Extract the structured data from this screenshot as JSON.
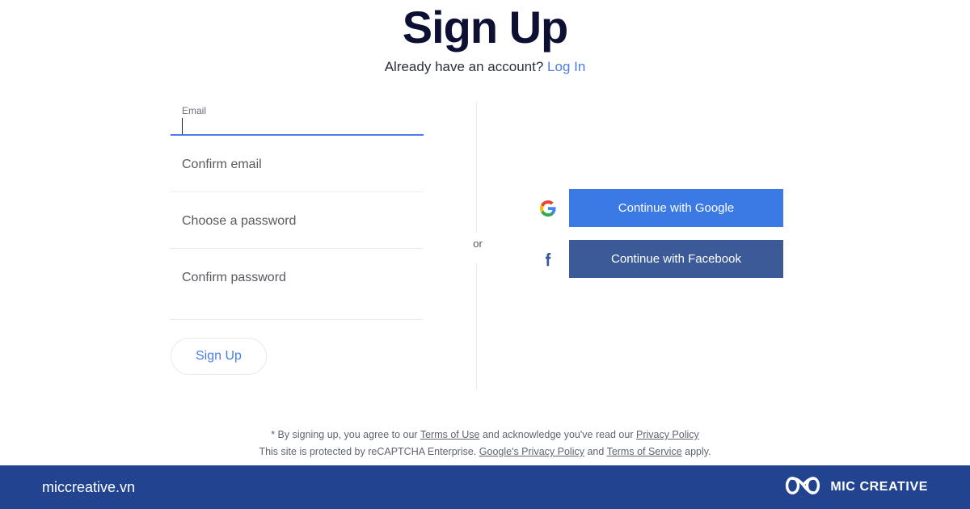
{
  "header": {
    "title": "Sign Up",
    "subtitle_text": "Already have an account?",
    "login_link": "Log In"
  },
  "form": {
    "email": {
      "label": "Email",
      "value": "",
      "placeholder": "Email",
      "focused": true
    },
    "confirm_email": {
      "placeholder": "Confirm email",
      "value": ""
    },
    "password": {
      "placeholder": "Choose a password",
      "value": ""
    },
    "confirm_password": {
      "placeholder": "Confirm password",
      "value": ""
    },
    "submit_label": "Sign Up"
  },
  "divider": {
    "or_label": "or"
  },
  "social": {
    "google": {
      "label": "Continue with Google",
      "icon": "google-g-icon",
      "color": "#3b7ae4"
    },
    "facebook": {
      "label": "Continue with Facebook",
      "icon": "facebook-f-icon",
      "color": "#3d5a98"
    }
  },
  "legal": {
    "line1_prefix": "* By signing up, you agree to our ",
    "terms_of_use": "Terms of Use",
    "line1_middle": " and acknowledge you've read our ",
    "privacy_policy": "Privacy Policy",
    "line2_prefix": "This site is protected by reCAPTCHA Enterprise. ",
    "google_privacy_policy": "Google's Privacy Policy",
    "line2_middle": " and ",
    "terms_of_service": "Terms of Service",
    "line2_suffix": " apply."
  },
  "brand_bar": {
    "site": "miccreative.vn",
    "name": "MIC CREATIVE",
    "logo": "infinity-knot-logo",
    "background": "#22438f"
  },
  "theme": {
    "accent_blue": "#4a7dea",
    "title_navy": "#0d1033",
    "google_blue": "#3b7ae4",
    "facebook_blue": "#3d5a98",
    "underline_gray": "#ececee"
  }
}
